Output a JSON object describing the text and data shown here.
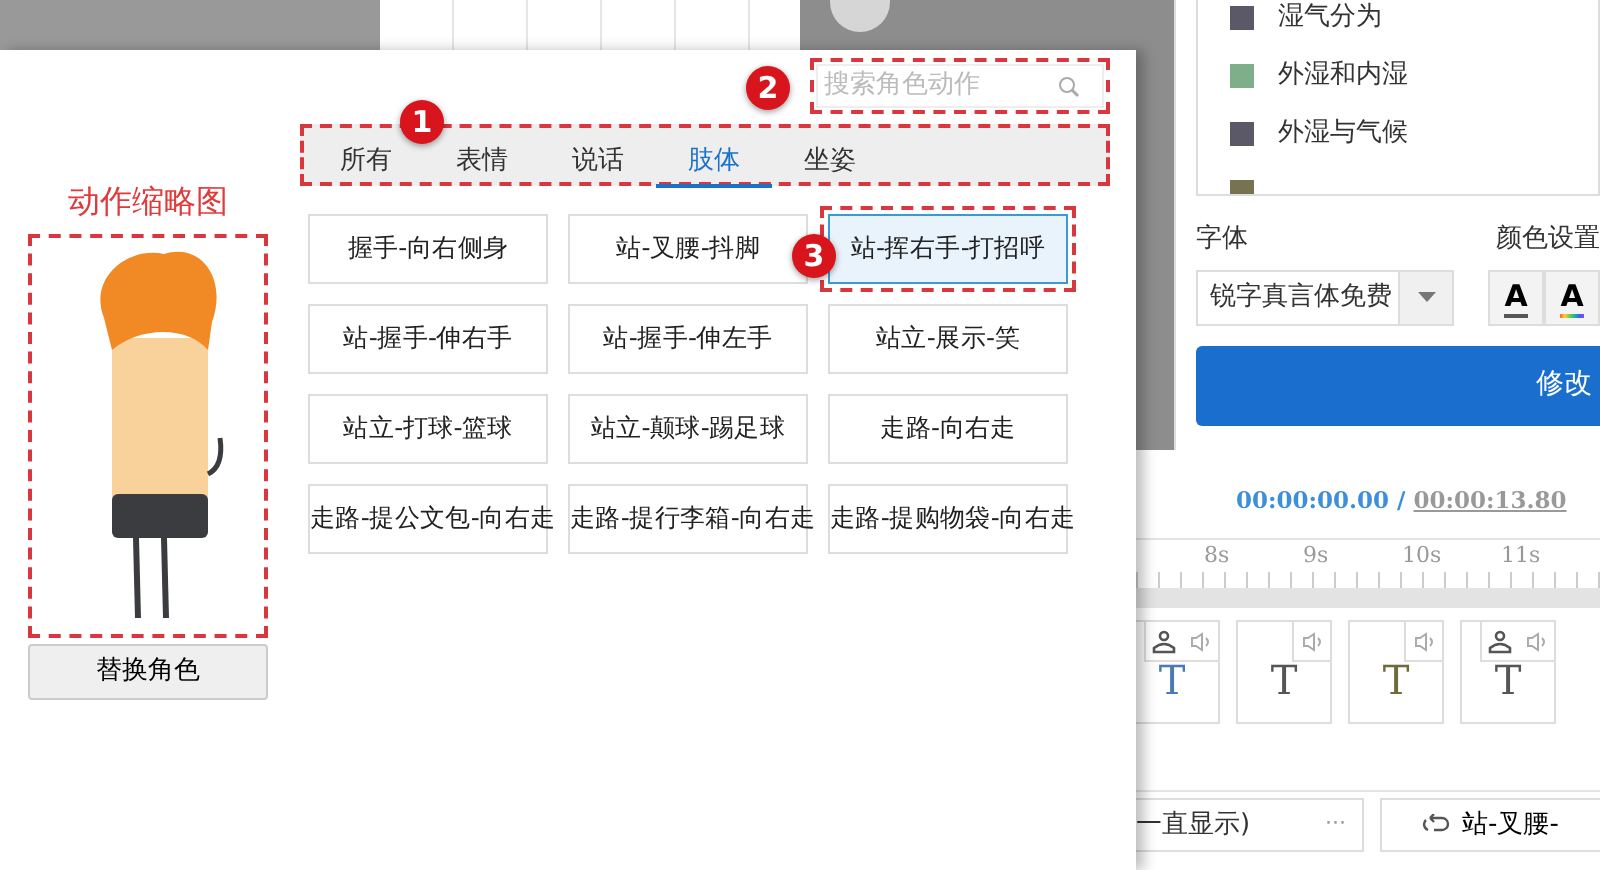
{
  "dialog": {
    "callouts": [
      "1",
      "2",
      "3"
    ],
    "search": {
      "placeholder": "搜索角色动作"
    },
    "tabs": [
      {
        "label": "所有",
        "selected": false
      },
      {
        "label": "表情",
        "selected": false
      },
      {
        "label": "说话",
        "selected": false
      },
      {
        "label": "肢体",
        "selected": true
      },
      {
        "label": "坐姿",
        "selected": false
      }
    ],
    "thumbnail_label": "动作缩略图",
    "replace_button": "替换角色",
    "actions": [
      {
        "label": "握手-向右侧身",
        "selected": false
      },
      {
        "label": "站-叉腰-抖脚",
        "selected": false
      },
      {
        "label": "站-挥右手-打招呼",
        "selected": true
      },
      {
        "label": "站-握手-伸右手",
        "selected": false
      },
      {
        "label": "站-握手-伸左手",
        "selected": false
      },
      {
        "label": "站立-展示-笑",
        "selected": false
      },
      {
        "label": "站立-打球-篮球",
        "selected": false
      },
      {
        "label": "站立-颠球-踢足球",
        "selected": false
      },
      {
        "label": "走路-向右走",
        "selected": false
      },
      {
        "label": "走路-提公文包-向右走",
        "selected": false
      },
      {
        "label": "走路-提行李箱-向右走",
        "selected": false
      },
      {
        "label": "走路-提购物袋-向右走",
        "selected": false
      }
    ]
  },
  "side_panel": {
    "legend": [
      {
        "label": "湿气分为",
        "color": "#5b5868"
      },
      {
        "label": "外湿和内湿",
        "color": "#7fae8a"
      },
      {
        "label": "外湿与气候",
        "color": "#5b5868"
      },
      {
        "color": "#77724f"
      }
    ],
    "font_label": "字体",
    "font_value": "锐字真言体免费",
    "color_label": "颜色设置",
    "color_buttons": [
      {
        "glyph": "A",
        "kind": "plain"
      },
      {
        "glyph": "A",
        "kind": "rainbow"
      }
    ],
    "apply_button": "修改"
  },
  "timeline": {
    "current_time": "00:00:00.00",
    "separator": "/",
    "total_time": "00:00:13.80",
    "ruler": [
      "8s",
      "9s",
      "10s",
      "11s"
    ],
    "clips": [
      {
        "glyph": "T",
        "color": "#4a78b8",
        "motion": true
      },
      {
        "glyph": "T",
        "color": "#555555",
        "motion": false
      },
      {
        "glyph": "T",
        "color": "#6f6a3a",
        "motion": false
      },
      {
        "glyph": "T",
        "color": "#555555",
        "motion": true
      }
    ],
    "caption_field": "一直显示)",
    "more": "···",
    "action_button": "站-叉腰-"
  }
}
